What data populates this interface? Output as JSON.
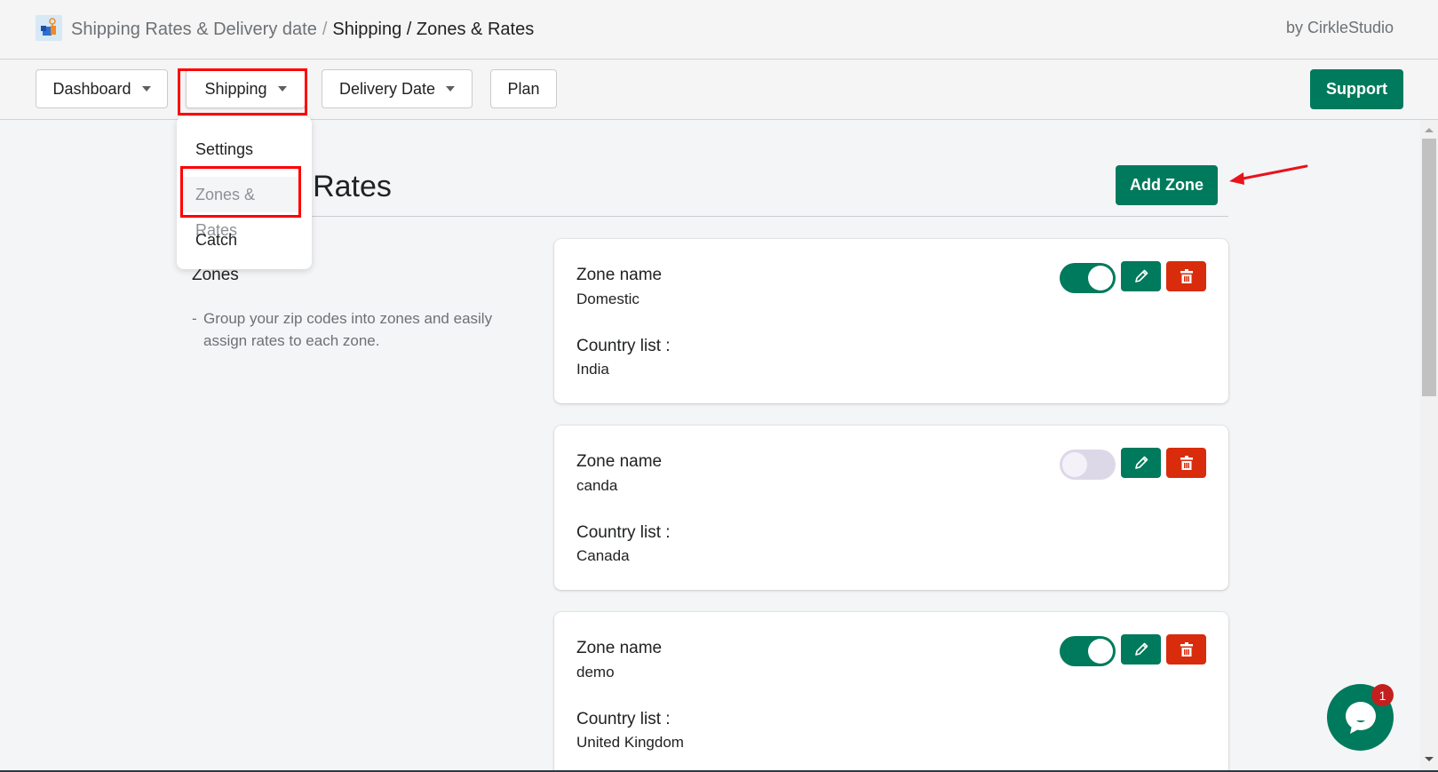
{
  "header": {
    "app_icon": "shipping-box-pin-icon",
    "breadcrumb_root": "Shipping Rates & Delivery date",
    "breadcrumb_separator": "/",
    "breadcrumb_current": "Shipping / Zones & Rates",
    "byline": "by CirkleStudio"
  },
  "nav": {
    "items": [
      {
        "label": "Dashboard",
        "has_dropdown": true
      },
      {
        "label": "Shipping",
        "has_dropdown": true,
        "open": true
      },
      {
        "label": "Delivery Date",
        "has_dropdown": true
      },
      {
        "label": "Plan",
        "has_dropdown": false
      }
    ],
    "support_label": "Support",
    "shipping_menu": [
      {
        "label": "Settings"
      },
      {
        "label": "Zones & Rates",
        "active": true
      },
      {
        "label": "Catch"
      }
    ]
  },
  "page": {
    "title": "Zones & Rates",
    "add_zone_label": "Add Zone",
    "section_heading": "Zones",
    "section_bullet": "-",
    "section_description": "Group your zip codes into zones and easily assign rates to each zone."
  },
  "zones": [
    {
      "zone_label": "Zone name",
      "zone_name": "Domestic",
      "country_label": "Country list :",
      "countries": "India",
      "enabled": true
    },
    {
      "zone_label": "Zone name",
      "zone_name": "canda",
      "country_label": "Country list :",
      "countries": "Canada",
      "enabled": false
    },
    {
      "zone_label": "Zone name",
      "zone_name": "demo",
      "country_label": "Country list :",
      "countries": "United Kingdom",
      "enabled": true
    }
  ],
  "chat": {
    "icon": "chat-bubble-icon",
    "badge_count": "1"
  },
  "colors": {
    "primary": "#007a5c",
    "danger": "#d82c0d",
    "annotation": "#ff0000",
    "toggle_off": "#ddd8e8"
  }
}
